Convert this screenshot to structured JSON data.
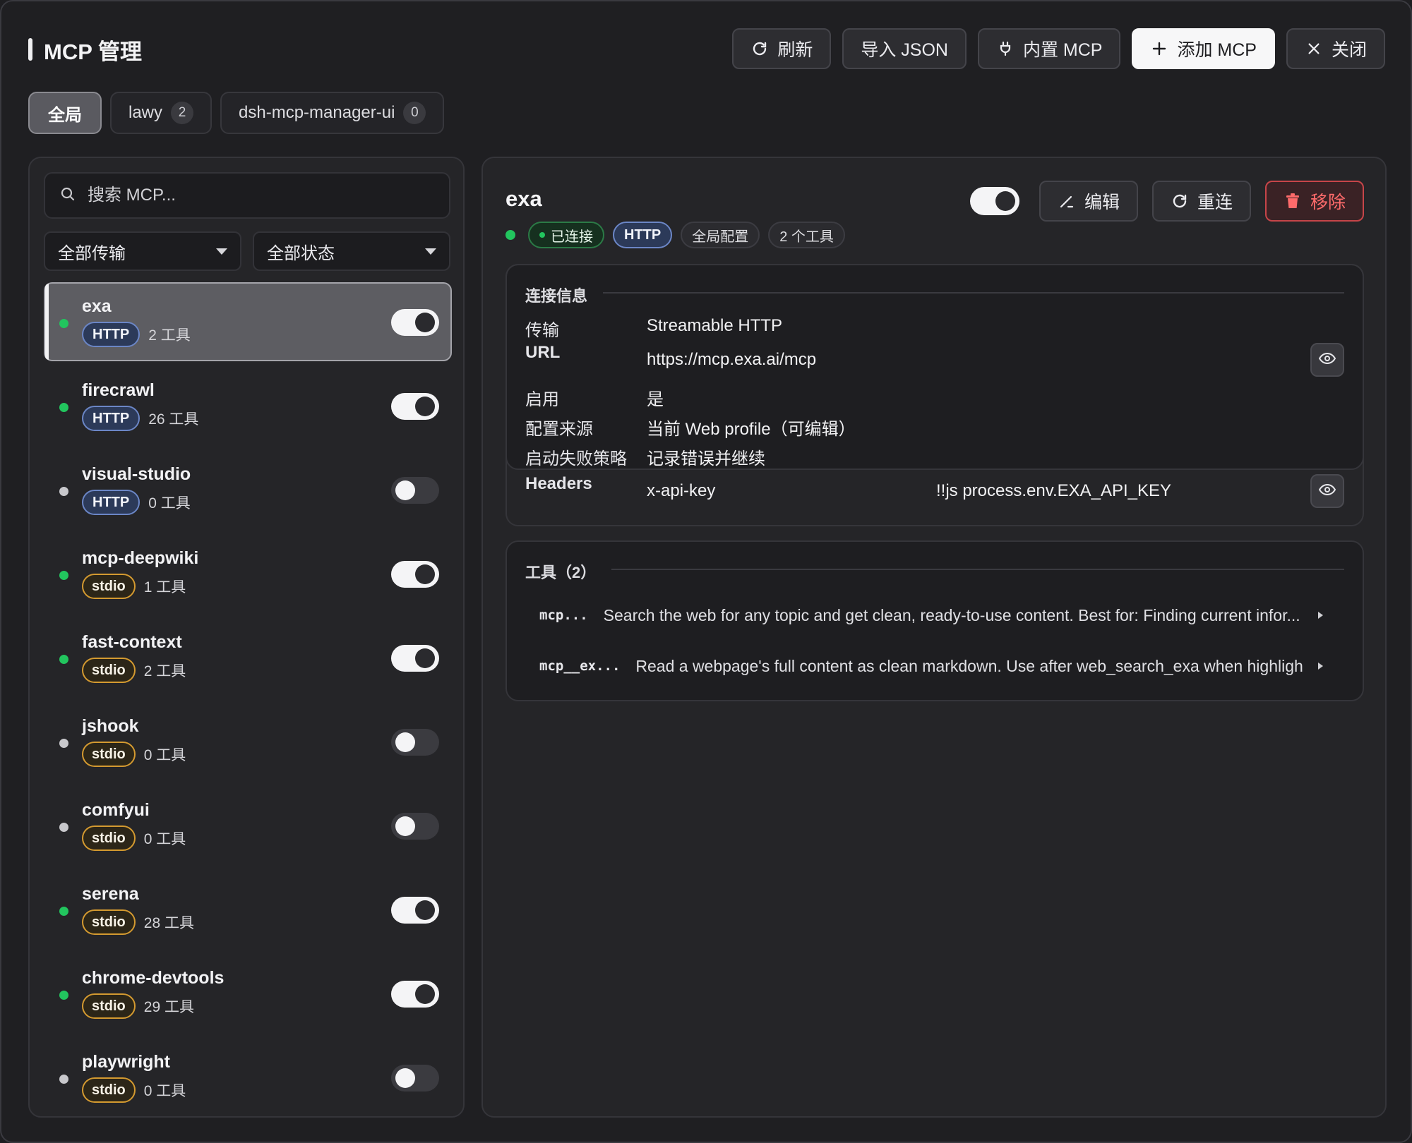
{
  "header": {
    "title": "MCP 管理",
    "refresh_label": "刷新",
    "import_label": "导入 JSON",
    "builtin_label": "内置 MCP",
    "add_label": "添加 MCP",
    "close_label": "关闭"
  },
  "scopes": [
    {
      "label": "全局",
      "count": null
    },
    {
      "label": "lawy",
      "count": "2"
    },
    {
      "label": "dsh-mcp-manager-ui",
      "count": "0"
    }
  ],
  "search": {
    "placeholder": "搜索 MCP..."
  },
  "filters": {
    "transport": "全部传输",
    "status": "全部状态"
  },
  "servers": [
    {
      "name": "exa",
      "transport": "HTTP",
      "tools": "2 工具",
      "online": true,
      "enabled": true,
      "selected": true
    },
    {
      "name": "firecrawl",
      "transport": "HTTP",
      "tools": "26 工具",
      "online": true,
      "enabled": true
    },
    {
      "name": "visual-studio",
      "transport": "HTTP",
      "tools": "0 工具",
      "online": false,
      "enabled": false
    },
    {
      "name": "mcp-deepwiki",
      "transport": "stdio",
      "tools": "1 工具",
      "online": true,
      "enabled": true
    },
    {
      "name": "fast-context",
      "transport": "stdio",
      "tools": "2 工具",
      "online": true,
      "enabled": true
    },
    {
      "name": "jshook",
      "transport": "stdio",
      "tools": "0 工具",
      "online": false,
      "enabled": false
    },
    {
      "name": "comfyui",
      "transport": "stdio",
      "tools": "0 工具",
      "online": false,
      "enabled": false
    },
    {
      "name": "serena",
      "transport": "stdio",
      "tools": "28 工具",
      "online": true,
      "enabled": true
    },
    {
      "name": "chrome-devtools",
      "transport": "stdio",
      "tools": "29 工具",
      "online": true,
      "enabled": true
    },
    {
      "name": "playwright",
      "transport": "stdio",
      "tools": "0 工具",
      "online": false,
      "enabled": false
    }
  ],
  "detail": {
    "name": "exa",
    "edit_label": "编辑",
    "reconnect_label": "重连",
    "remove_label": "移除",
    "chips": {
      "status": "已连接",
      "transport": "HTTP",
      "scope": "全局配置",
      "tools": "2 个工具"
    },
    "connection": {
      "title": "连接信息",
      "rows": [
        {
          "label": "传输",
          "value": "Streamable HTTP"
        },
        {
          "label": "URL",
          "value": "https://mcp.exa.ai/mcp"
        },
        {
          "label": "启用",
          "value": "是"
        },
        {
          "label": "配置来源",
          "value": "当前 Web profile（可编辑）"
        },
        {
          "label": "启动失败策略",
          "value": "记录错误并继续"
        },
        {
          "label": "Headers",
          "value": "x-api-key",
          "extra": "!!js process.env.EXA_API_KEY"
        }
      ]
    },
    "tools": {
      "title": "工具（2）",
      "items": [
        {
          "name": "mcp...",
          "desc": "Search the web for any topic and get clean, ready-to-use content. Best for: Finding current infor..."
        },
        {
          "name": "mcp__ex...",
          "desc": "Read a webpage's full content as clean markdown. Use after web_search_exa when highlight..."
        }
      ]
    }
  },
  "colors": {
    "accent_green": "#22c55e",
    "http_blue": "#6b86c6",
    "stdio_amber": "#d49a30",
    "danger": "#ff6b6b"
  }
}
